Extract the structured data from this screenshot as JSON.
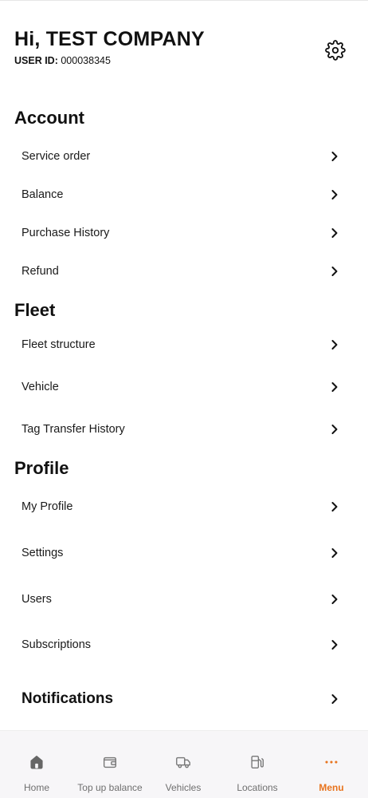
{
  "header": {
    "greeting": "Hi, TEST COMPANY",
    "user_id_label": "USER ID:",
    "user_id_value": "000038345"
  },
  "sections": {
    "account": {
      "title": "Account",
      "items": [
        "Service order",
        "Balance",
        "Purchase History",
        "Refund"
      ]
    },
    "fleet": {
      "title": "Fleet",
      "items": [
        "Fleet structure",
        "Vehicle",
        "Tag Transfer History"
      ]
    },
    "profile": {
      "title": "Profile",
      "items": [
        "My Profile",
        "Settings",
        "Users",
        "Subscriptions"
      ]
    },
    "notifications": {
      "label": "Notifications"
    }
  },
  "tabbar": {
    "active": "Menu",
    "accent_color": "#e8741e",
    "items": [
      {
        "label": "Home",
        "icon": "home-icon"
      },
      {
        "label": "Top up balance",
        "icon": "wallet-icon"
      },
      {
        "label": "Vehicles",
        "icon": "truck-icon"
      },
      {
        "label": "Locations",
        "icon": "fuel-station-icon"
      },
      {
        "label": "Menu",
        "icon": "more-dots-icon"
      }
    ]
  }
}
